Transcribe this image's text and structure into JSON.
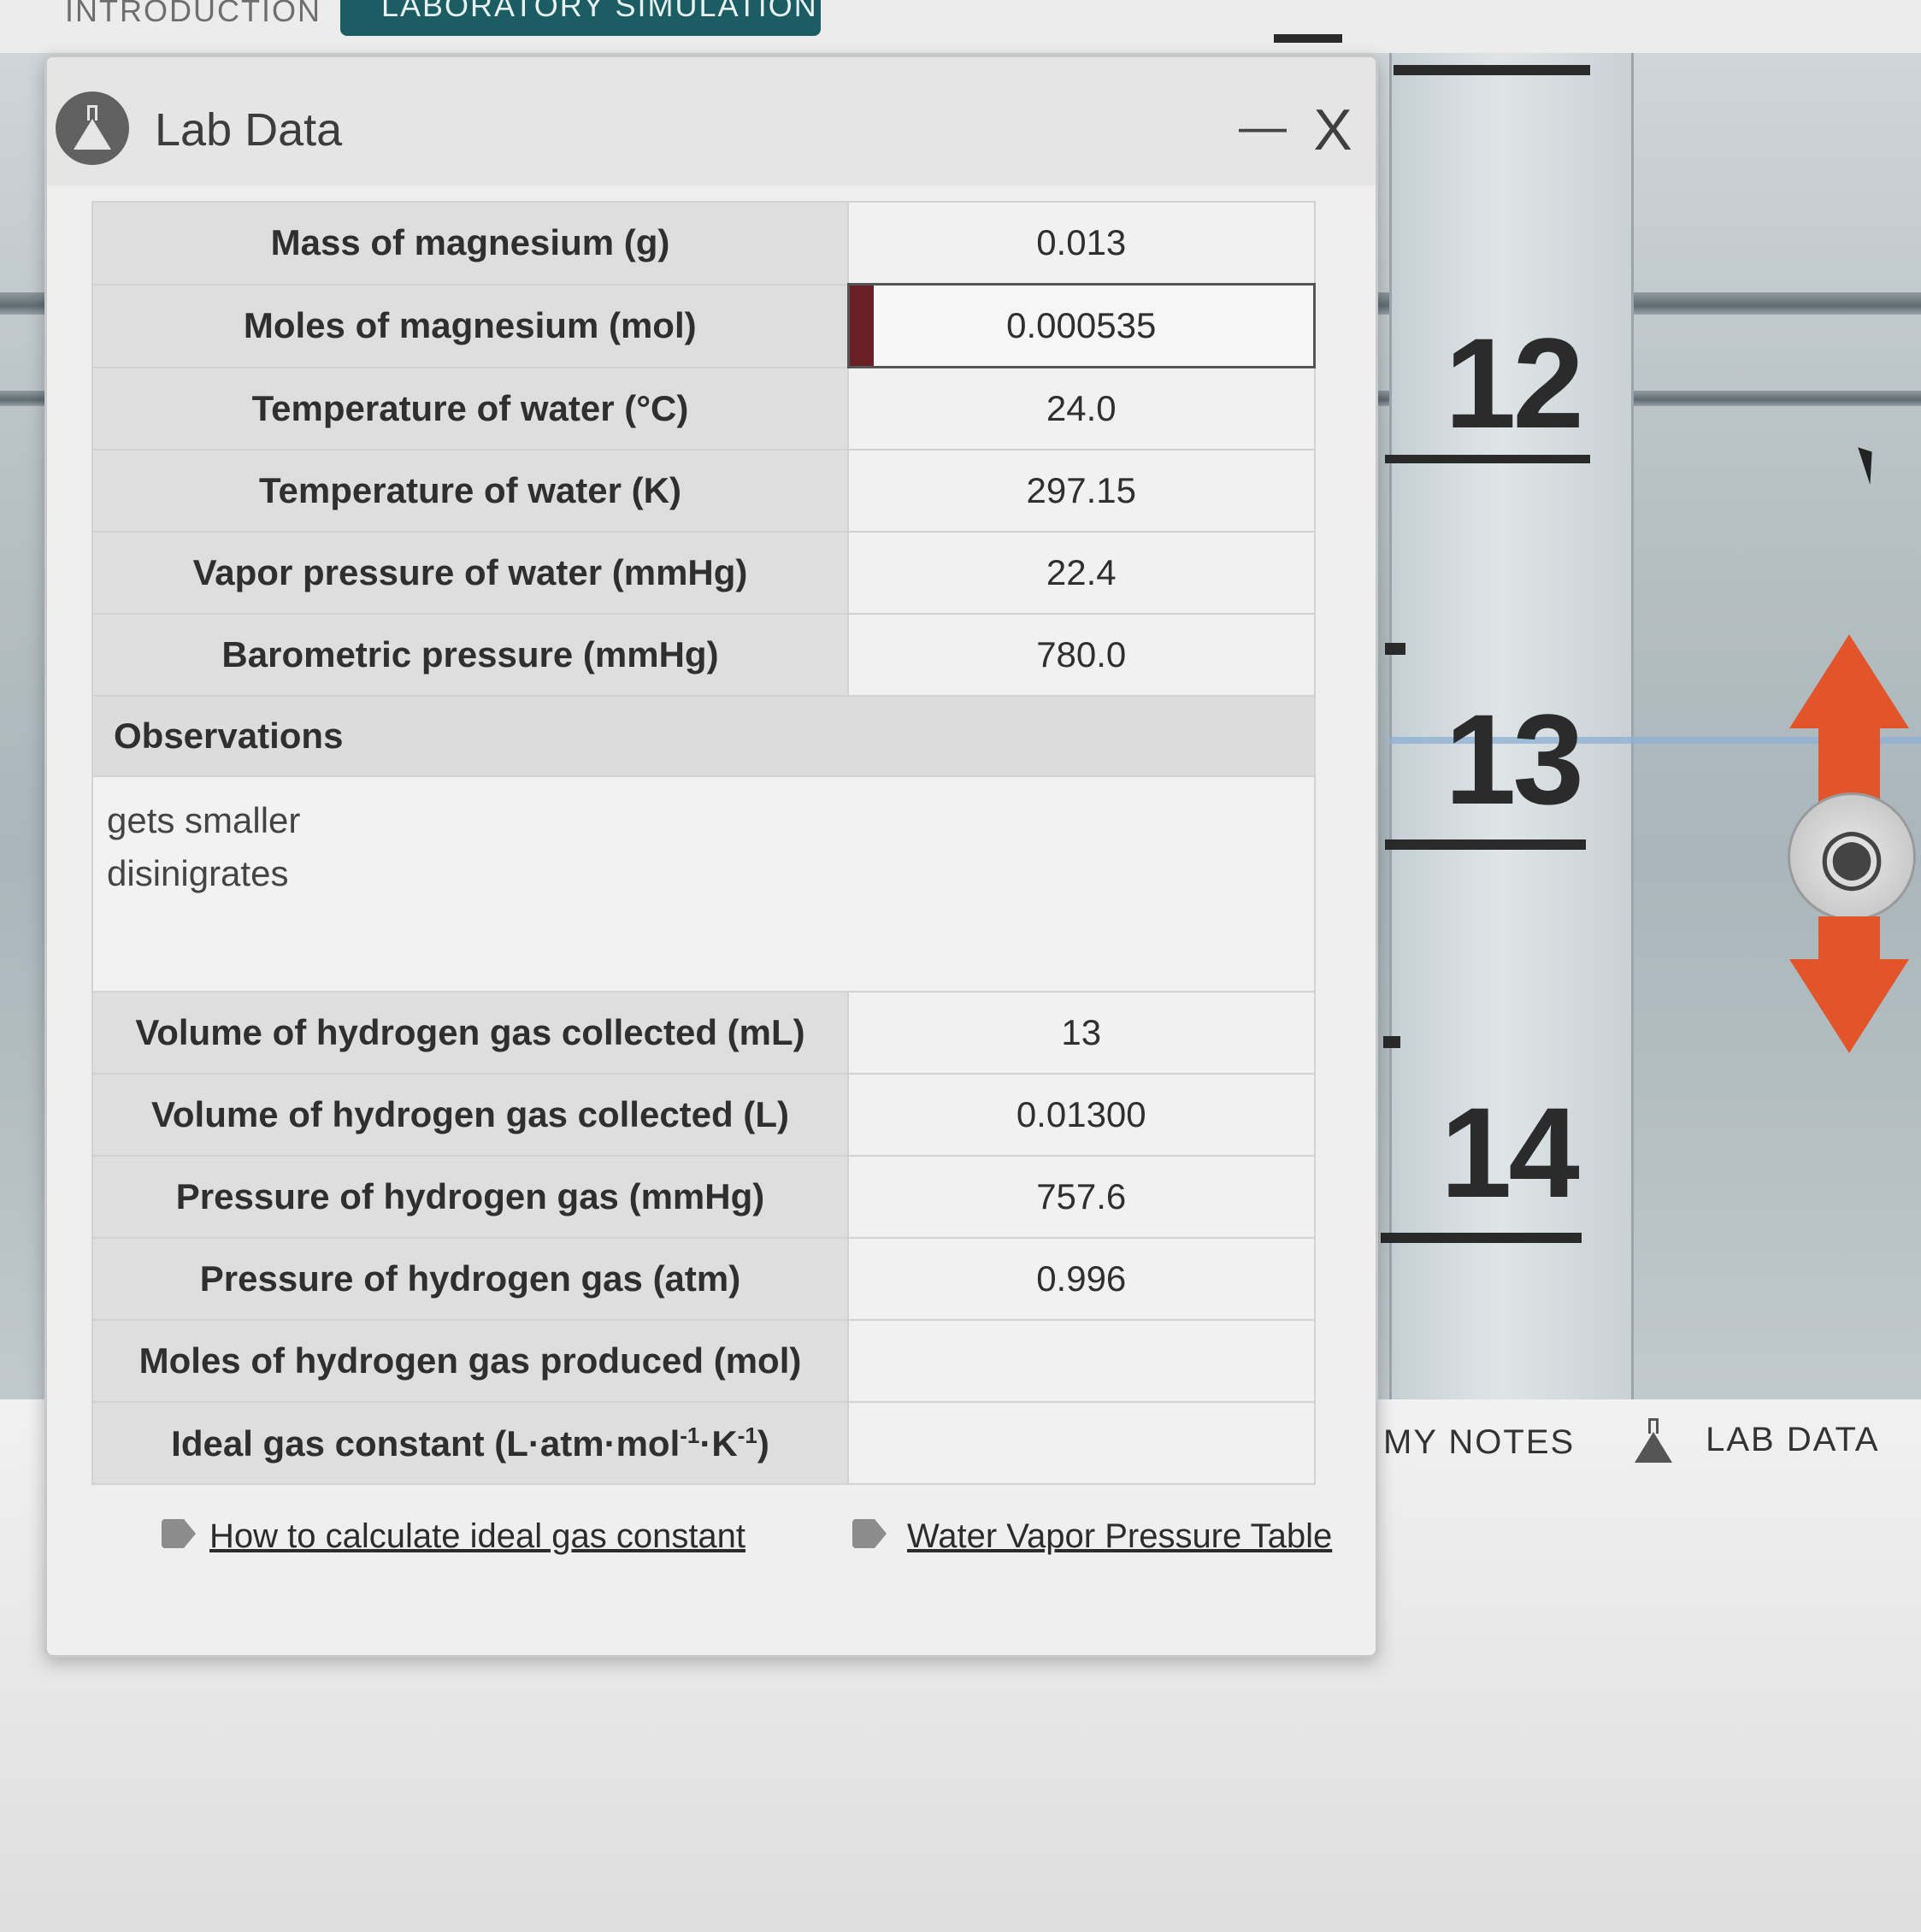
{
  "tabs": {
    "introduction": "INTRODUCTION",
    "simulation": "LABORATORY SIMULATION"
  },
  "scale": {
    "numbers": [
      "12",
      "13",
      "14"
    ]
  },
  "slider": {
    "up_icon": "arrow-up-icon",
    "eye_icon": "eye-icon",
    "down_icon": "arrow-down-icon"
  },
  "bottom_nav": {
    "my_notes": "MY NOTES",
    "lab_data": "LAB DATA"
  },
  "panel": {
    "title": "Lab Data",
    "minimize_label": "—",
    "close_label": "X",
    "rows_top": [
      {
        "label": "Mass of magnesium (g)",
        "value": "0.013"
      },
      {
        "label": "Moles of magnesium (mol)",
        "value": "0.000535"
      },
      {
        "label": "Temperature of water (°C)",
        "value": "24.0"
      },
      {
        "label": "Temperature of water (K)",
        "value": "297.15"
      },
      {
        "label": "Vapor pressure of water (mmHg)",
        "value": "22.4"
      },
      {
        "label": "Barometric pressure (mmHg)",
        "value": "780.0"
      }
    ],
    "observations": {
      "heading": "Observations",
      "line1": "gets smaller",
      "line2": "disinigrates"
    },
    "rows_bottom": [
      {
        "label": "Volume of hydrogen gas collected (mL)",
        "value": "13"
      },
      {
        "label": "Volume of hydrogen gas collected (L)",
        "value": "0.01300"
      },
      {
        "label": "Pressure of hydrogen gas (mmHg)",
        "value": "757.6"
      },
      {
        "label": "Pressure of hydrogen gas (atm)",
        "value": "0.996"
      },
      {
        "label": "Moles of hydrogen gas produced (mol)",
        "value": ""
      },
      {
        "label_main": "Ideal gas constant (L·atm·mol",
        "label_exp1": "-1",
        "label_mid": "·K",
        "label_exp2": "-1",
        "label_end": ")",
        "value": ""
      }
    ],
    "links": {
      "ideal_gas": "How to calculate ideal gas constant",
      "vapor_table": "Water Vapor Pressure Table"
    }
  },
  "colors": {
    "tab_active": "#1c5c63",
    "active_marker": "#6a1e26",
    "arrow": "#e2552b"
  }
}
